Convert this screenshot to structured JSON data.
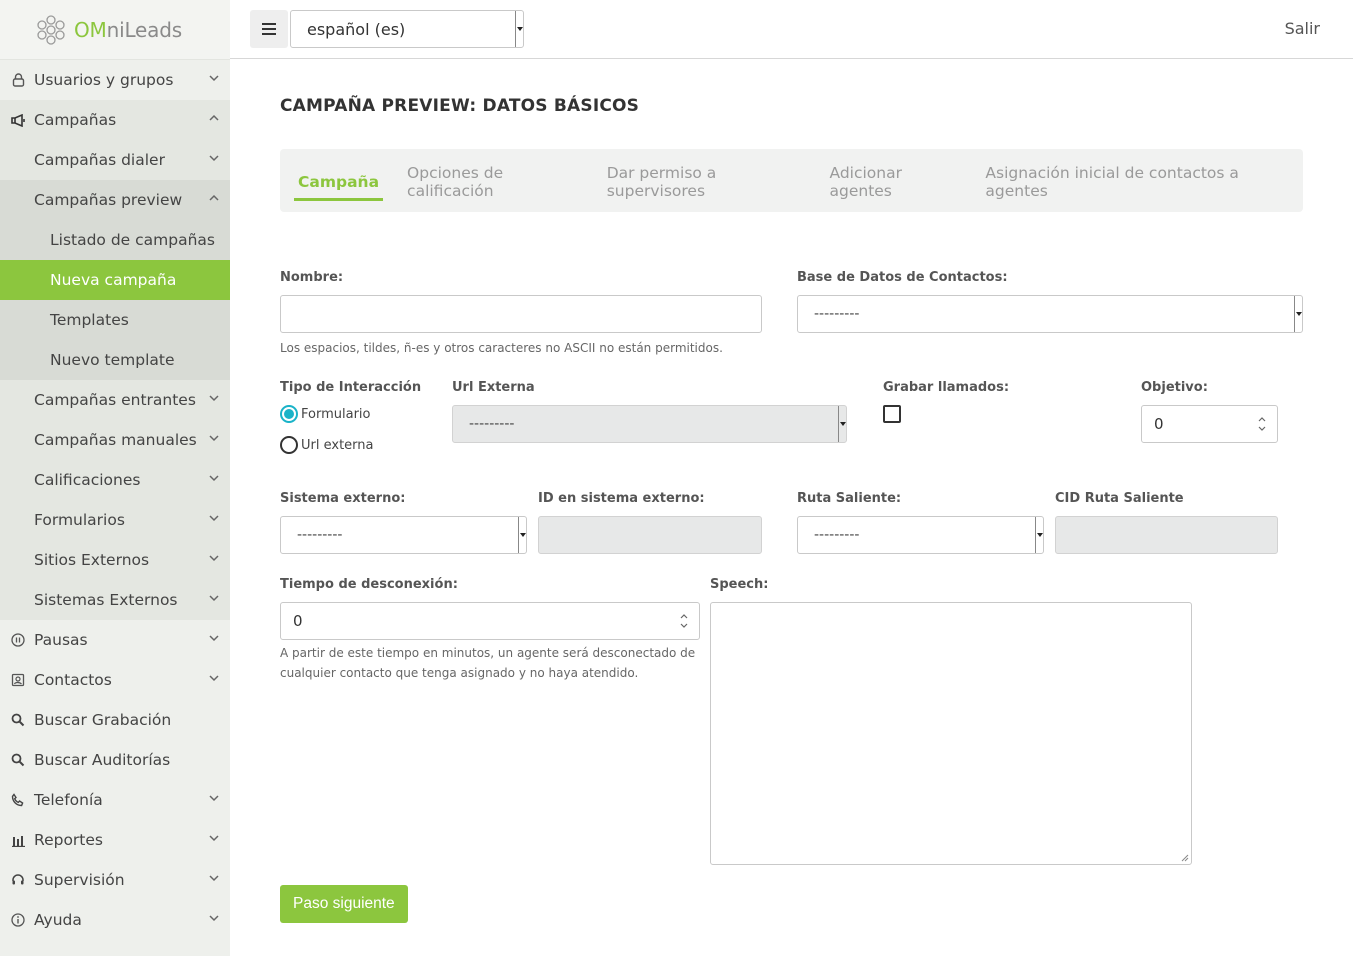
{
  "brand": {
    "logo_text_accent": "OM",
    "logo_text_rest": "niLeads"
  },
  "topbar": {
    "language_selected": "español (es)",
    "logout_label": "Salir"
  },
  "sidebar": {
    "items": [
      {
        "label": "Usuarios y grupos",
        "icon": "lock-icon"
      },
      {
        "label": "Campañas",
        "icon": "megaphone-icon"
      },
      {
        "label": "Campañas dialer"
      },
      {
        "label": "Campañas preview"
      },
      {
        "label": "Listado de campañas"
      },
      {
        "label": "Nueva campaña"
      },
      {
        "label": "Templates"
      },
      {
        "label": "Nuevo template"
      },
      {
        "label": "Campañas entrantes"
      },
      {
        "label": "Campañas manuales"
      },
      {
        "label": "Calificaciones"
      },
      {
        "label": "Formularios"
      },
      {
        "label": "Sitios Externos"
      },
      {
        "label": "Sistemas Externos"
      },
      {
        "label": "Pausas",
        "icon": "pause-icon"
      },
      {
        "label": "Contactos",
        "icon": "contacts-icon"
      },
      {
        "label": "Buscar Grabación",
        "icon": "search-icon"
      },
      {
        "label": "Buscar Auditorías",
        "icon": "search-icon"
      },
      {
        "label": "Telefonía",
        "icon": "phone-icon"
      },
      {
        "label": "Reportes",
        "icon": "bar-chart-icon"
      },
      {
        "label": "Supervisión",
        "icon": "headset-icon"
      },
      {
        "label": "Ayuda",
        "icon": "info-icon"
      }
    ]
  },
  "main": {
    "title": "CAMPAÑA PREVIEW: DATOS BÁSICOS",
    "tabs": [
      {
        "label": "Campaña"
      },
      {
        "label": "Opciones de calificación"
      },
      {
        "label": "Dar permiso a supervisores"
      },
      {
        "label": "Adicionar agentes"
      },
      {
        "label": "Asignación inicial de contactos a agentes"
      }
    ],
    "form": {
      "nombre_label": "Nombre:",
      "nombre_value": "",
      "nombre_help": "Los espacios, tildes, ñ-es y otros caracteres no ASCII no están permitidos.",
      "bd_label": "Base de Datos de Contactos:",
      "bd_value": "---------",
      "tipo_label": "Tipo de Interacción",
      "tipo_option_1": "Formulario",
      "tipo_option_2": "Url externa",
      "url_label": "Url Externa",
      "url_value": "---------",
      "grabar_label": "Grabar llamados:",
      "objetivo_label": "Objetivo:",
      "objetivo_value": "0",
      "sistema_label": "Sistema externo:",
      "sistema_value": "---------",
      "id_label": "ID en sistema externo:",
      "ruta_label": "Ruta Saliente:",
      "ruta_value": "---------",
      "cid_label": "CID Ruta Saliente",
      "tiempo_label": "Tiempo de desconexión:",
      "tiempo_value": "0",
      "tiempo_help_1": "A partir de este tiempo en minutos, un agente será desconectado de",
      "tiempo_help_2": "cualquier contacto que tenga asignado y no haya atendido.",
      "speech_label": "Speech:",
      "next_button": "Paso siguiente"
    }
  },
  "colors": {
    "accent": "#8cc63e",
    "radio": "#1ab3c8"
  }
}
